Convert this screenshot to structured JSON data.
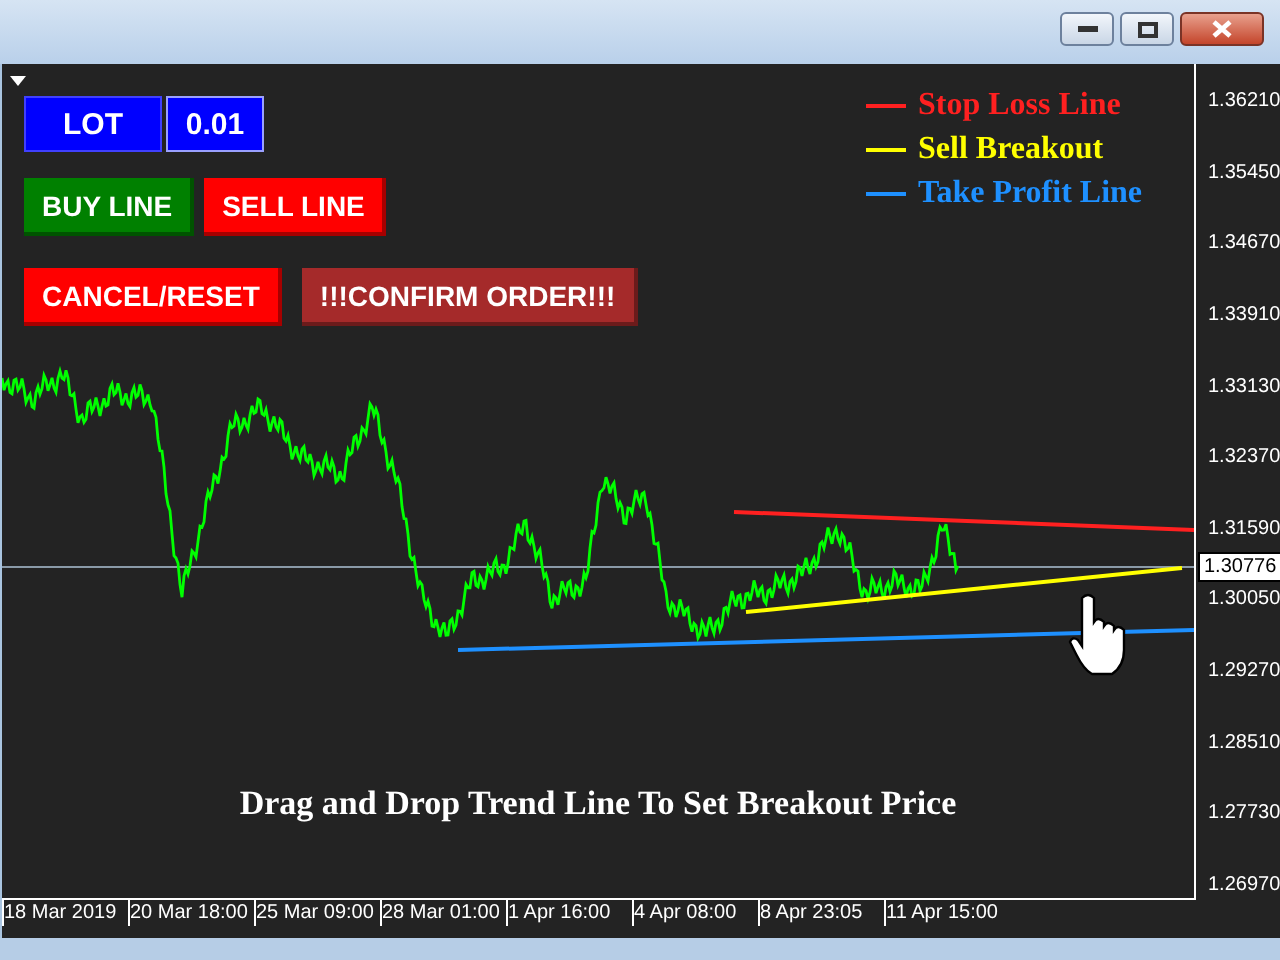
{
  "panel": {
    "lot": {
      "label": "LOT",
      "value": "0.01"
    },
    "button_rows": [
      [
        {
          "label": "BUY LINE",
          "color": "#008000"
        },
        {
          "label": "SELL LINE",
          "color": "#ff0000"
        }
      ],
      [
        {
          "label": "CANCEL/RESET",
          "color": "#ff0000"
        },
        {
          "label": "!!!CONFIRM ORDER!!!",
          "color": "#a52a2a"
        }
      ]
    ]
  },
  "legend": [
    {
      "label": "Stop Loss Line",
      "color": "#ff2020"
    },
    {
      "label": "Sell Breakout",
      "color": "#ffff00"
    },
    {
      "label": "Take Profit Line",
      "color": "#1e90ff"
    }
  ],
  "caption": "Drag and Drop Trend Line To Set Breakout Price",
  "price_axis": {
    "ticks": [
      "1.36210",
      "1.35450",
      "1.34670",
      "1.33910",
      "1.33130",
      "1.32370",
      "1.31590",
      "1.30050",
      "1.29270",
      "1.28510",
      "1.27730",
      "1.26970"
    ],
    "current_price": "1.30776"
  },
  "time_axis": {
    "labels": [
      "18 Mar 2019",
      "20 Mar 18:00",
      "25 Mar 09:00",
      "28 Mar 01:00",
      "1 Apr 16:00",
      "4 Apr 08:00",
      "8 Apr 23:05",
      "11 Apr 15:00"
    ]
  }
}
